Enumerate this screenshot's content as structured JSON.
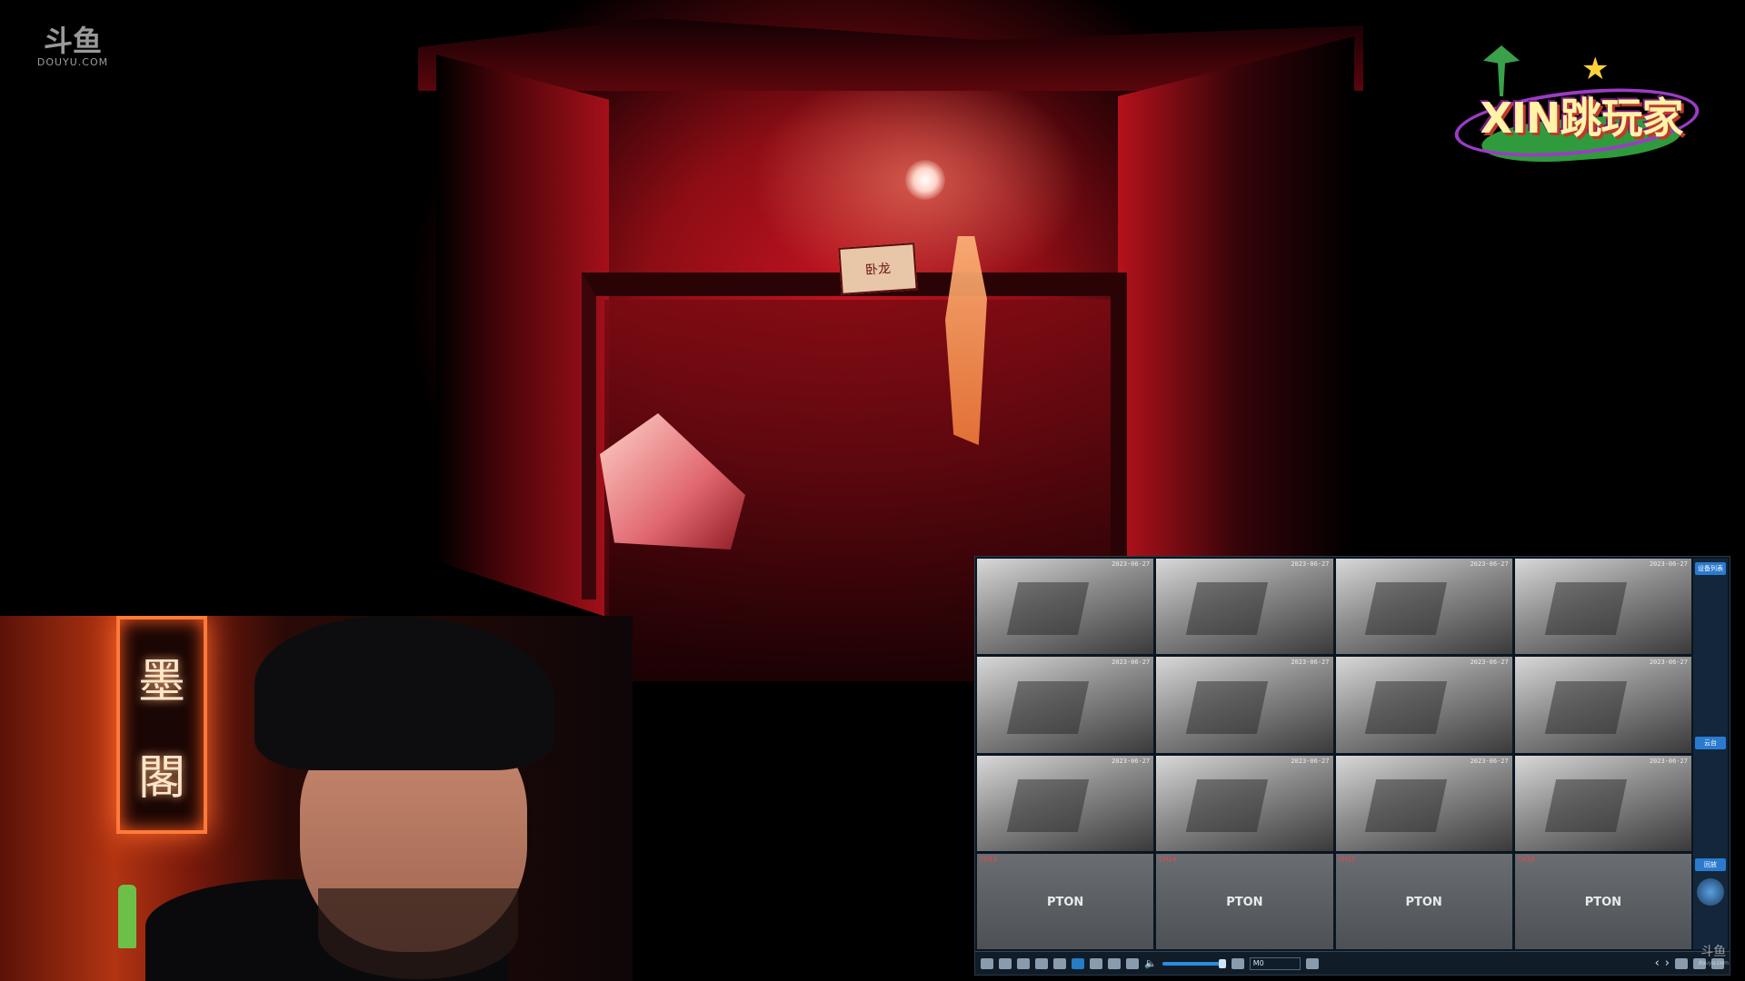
{
  "watermark": {
    "brand_cn": "斗鱼",
    "brand_en": "DOUYU.COM"
  },
  "show_logo": {
    "title": "XIN跳玩家"
  },
  "scene": {
    "door_sign": "卧龙"
  },
  "webcam": {
    "neon_sign": [
      "墨",
      "閣"
    ]
  },
  "dvr": {
    "brand": "PTON",
    "cameras": [
      {
        "ts": "2023-06-27"
      },
      {
        "ts": "2023-06-27"
      },
      {
        "ts": "2023-06-27"
      },
      {
        "ts": "2023-06-27"
      },
      {
        "ts": "2023-06-27"
      },
      {
        "ts": "2023-06-27"
      },
      {
        "ts": "2023-06-27"
      },
      {
        "ts": "2023-06-27"
      },
      {
        "ts": "2023-06-27"
      },
      {
        "ts": "2023-06-27"
      },
      {
        "ts": "2023-06-27"
      },
      {
        "ts": "2023-06-27"
      }
    ],
    "empty_channels": [
      "CH13",
      "CH14",
      "CH15",
      "CH16"
    ],
    "side_panel": {
      "top_button": "设备列表",
      "mid_button": "云台",
      "bottom_button": "回放"
    },
    "toolbar": {
      "stream_select": "M0",
      "volume": 0.9
    }
  },
  "corner_watermark": {
    "cn": "斗鱼",
    "en": "douyu.com"
  },
  "colors": {
    "accent_blue": "#2a8de0",
    "scene_red": "#c21320",
    "neon_orange": "#ff7a3a"
  }
}
